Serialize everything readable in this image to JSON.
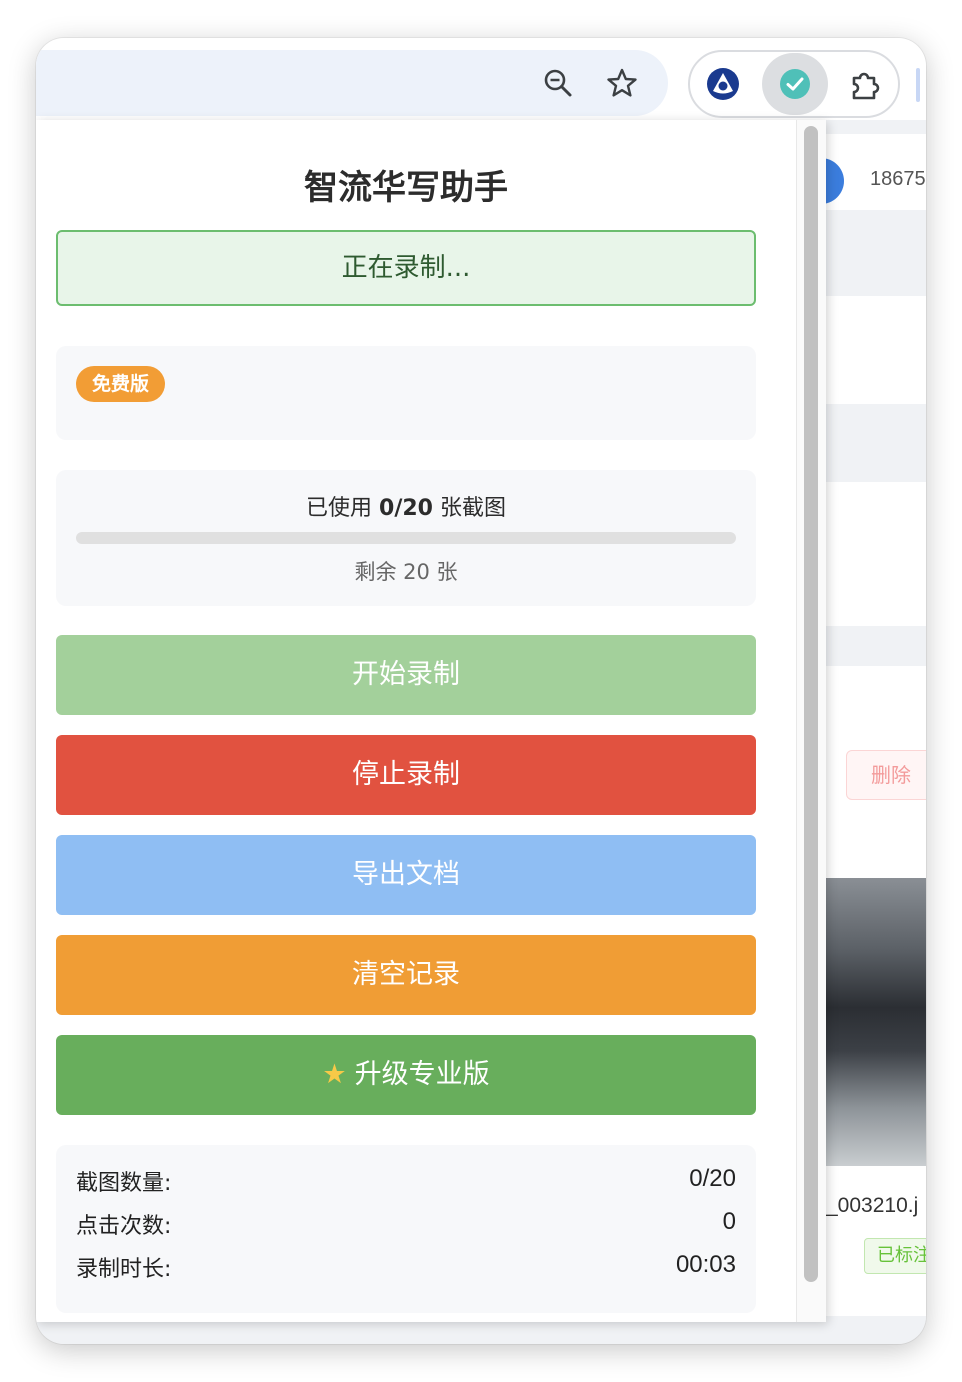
{
  "browser": {
    "toolbar_icons": [
      "zoom-out-icon",
      "bookmark-star-icon"
    ],
    "extensions": [
      "triangle-extension-icon",
      "check-extension-icon",
      "puzzle-extensions-icon"
    ]
  },
  "background_page": {
    "phone_partial": "18675",
    "delete_button_partial": "删除",
    "filename_partial": "_003210.j",
    "tag_partial": "已标注"
  },
  "popup": {
    "title": "智流华写助手",
    "status": "正在录制...",
    "plan_badge": "免费版",
    "usage": {
      "prefix": "已使用",
      "count": "0/20",
      "suffix": "张截图",
      "remaining": "剩余 20 张",
      "fraction_used": 0
    },
    "buttons": {
      "start": "开始录制",
      "stop": "停止录制",
      "export": "导出文档",
      "clear": "清空记录",
      "upgrade": "升级专业版"
    },
    "stats": [
      {
        "label": "截图数量:",
        "value": "0/20"
      },
      {
        "label": "点击次数:",
        "value": "0"
      },
      {
        "label": "录制时长:",
        "value": "00:03"
      }
    ]
  },
  "colors": {
    "start": "#a3d09b",
    "stop": "#e15240",
    "export": "#8fbef3",
    "clear": "#f09d35",
    "upgrade": "#68ae5c",
    "status_bg": "#e8f5e9",
    "badge": "#f29d35"
  }
}
